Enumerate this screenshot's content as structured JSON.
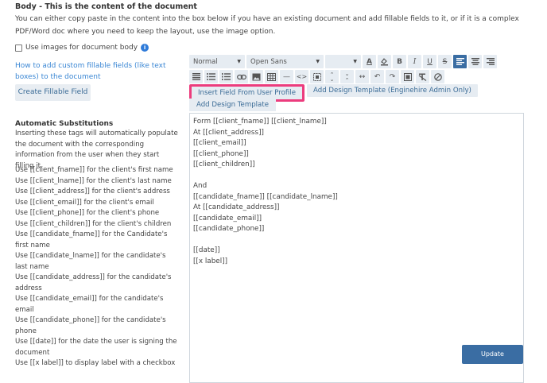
{
  "header": {
    "title": "Body - This is the content of the document",
    "intro": "You can either copy paste in the content into the box below if you have an existing document and add fillable fields to it, or if it is a complex PDF/Word doc where you need to keep the layout, use the image option."
  },
  "options": {
    "use_images_label": "Use images for document body",
    "use_images_checked": false
  },
  "sidebar": {
    "help_link": "How to add custom fillable fields (like text boxes) to the document",
    "create_button": "Create Fillable Field",
    "subs_title": "Automatic Substitutions",
    "subs_text": "Inserting these tags will automatically populate the document with the corresponding information from the user when they start filling it.",
    "subs_items": [
      "Use [[client_fname]] for the client's first name",
      "Use [[client_lname]] for the client's last name",
      "Use [[client_address]] for the client's address",
      "Use [[client_email]] for the client's email",
      "Use [[client_phone]] for the client's phone",
      "Use [[client_children]] for the client's children",
      "Use [[candidate_fname]] for the Candidate's first name",
      "Use [[candidate_lname]] for the candidate's last name",
      "Use [[candidate_address]] for the candidate's address",
      "Use [[candidate_email]] for the candidate's email",
      "Use [[candidate_phone]] for the candidate's phone",
      "Use [[date]] for the date the user is signing the document",
      "Use [[x label]] to display label with a checkbox"
    ]
  },
  "toolbar": {
    "style_select": "Normal",
    "font_select": "Open Sans",
    "size_select": "",
    "row1_icons": [
      "text-color-icon",
      "highlight-icon",
      "bold-icon",
      "italic-icon",
      "underline-icon",
      "strikethrough-icon",
      "align-left-icon",
      "align-center-icon",
      "align-right-icon"
    ],
    "row2_icons": [
      "align-justify-icon",
      "bullet-list-icon",
      "numbered-list-icon",
      "link-icon",
      "image-icon",
      "table-icon",
      "horizontal-rule-icon",
      "code-icon",
      "select-all-icon",
      "expand-icon",
      "collapse-icon",
      "width-icon",
      "undo-icon",
      "redo-icon",
      "grid-icon",
      "clear-format-icon",
      "block-icon"
    ],
    "active_align": "align-left-icon"
  },
  "tabs": {
    "insert_field": "Insert Field From User Profile",
    "add_design_template_admin": "Add Design Template (Enginehire Admin Only)",
    "add_design_template": "Add Design Template"
  },
  "editor": {
    "lines": [
      "Form [[client_fname]] [[client_lname]]",
      "At [[client_address]]",
      "[[client_email]]",
      "[[client_phone]]",
      "[[client_children]]",
      "",
      "And",
      "[[candidate_fname]] [[candidate_lname]]",
      "At [[candidate_address]]",
      "[[candidate_email]]",
      "[[candidate_phone]]",
      "",
      "[[date]]",
      "[[x label]]"
    ]
  },
  "footer": {
    "update_button": "Update"
  },
  "colors": {
    "accent": "#3a6da3",
    "link": "#3b87d4",
    "highlight_border": "#ec3c7d",
    "button_bg": "#e6ecf2"
  }
}
